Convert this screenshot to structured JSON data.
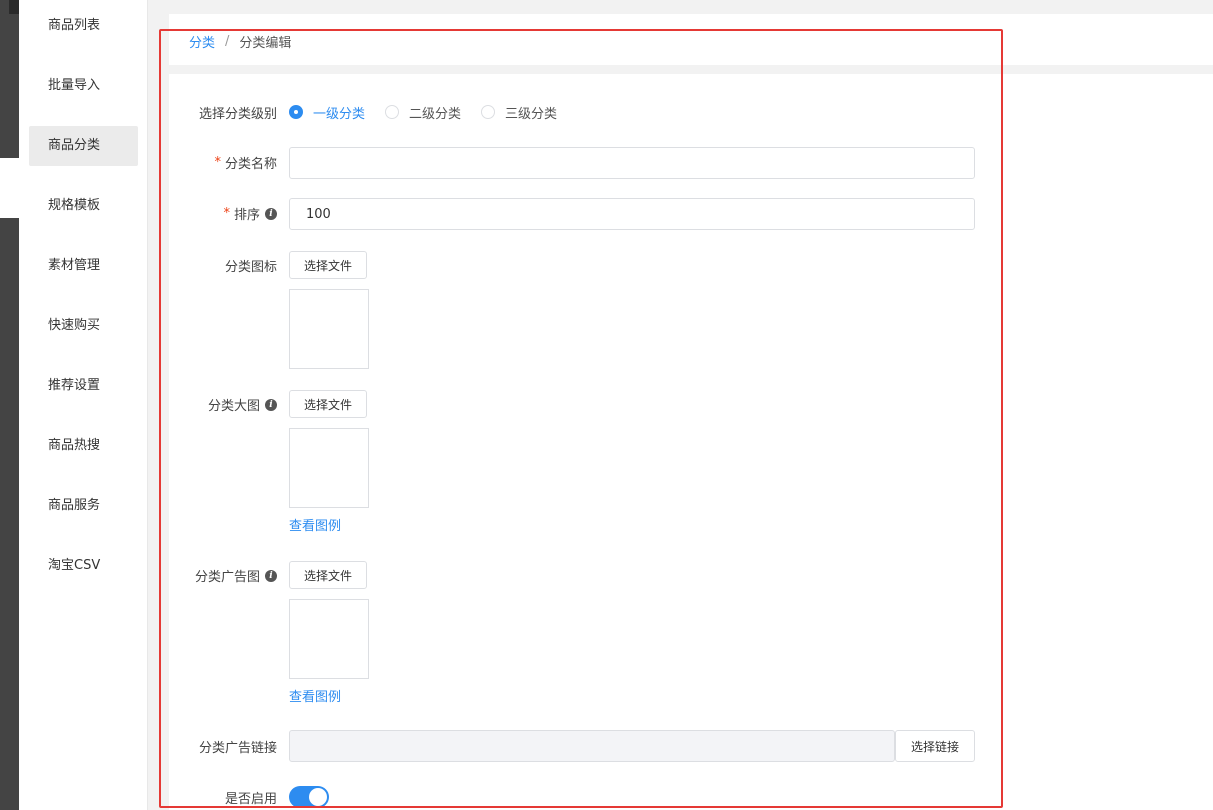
{
  "sidebar": {
    "items": [
      {
        "label": "商品列表",
        "active": false
      },
      {
        "label": "批量导入",
        "active": false
      },
      {
        "label": "商品分类",
        "active": true
      },
      {
        "label": "规格模板",
        "active": false
      },
      {
        "label": "素材管理",
        "active": false
      },
      {
        "label": "快速购买",
        "active": false
      },
      {
        "label": "推荐设置",
        "active": false
      },
      {
        "label": "商品热搜",
        "active": false
      },
      {
        "label": "商品服务",
        "active": false
      },
      {
        "label": "淘宝CSV",
        "active": false
      }
    ]
  },
  "breadcrumb": {
    "parent": "分类",
    "separator": "/",
    "current": "分类编辑"
  },
  "form": {
    "level": {
      "label": "选择分类级别",
      "options": [
        {
          "label": "一级分类",
          "checked": true
        },
        {
          "label": "二级分类",
          "checked": false
        },
        {
          "label": "三级分类",
          "checked": false
        }
      ]
    },
    "name": {
      "required_mark": "*",
      "label": "分类名称",
      "value": ""
    },
    "sort": {
      "required_mark": "*",
      "label": "排序",
      "value": "100"
    },
    "icon": {
      "label": "分类图标",
      "button": "选择文件"
    },
    "big_image": {
      "label": "分类大图",
      "button": "选择文件",
      "example_link": "查看图例"
    },
    "ad_image": {
      "label": "分类广告图",
      "button": "选择文件",
      "example_link": "查看图例"
    },
    "ad_link": {
      "label": "分类广告链接",
      "value": "",
      "button": "选择链接"
    },
    "enabled": {
      "label": "是否启用",
      "on": true
    }
  },
  "icons": {
    "info": "i"
  },
  "colors": {
    "primary": "#2d8cf0",
    "required": "#ed4014",
    "highlight": "#e53935"
  }
}
